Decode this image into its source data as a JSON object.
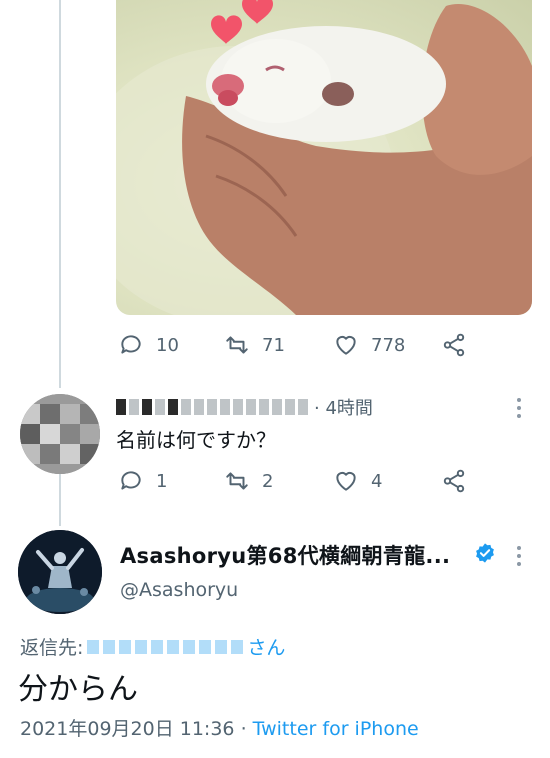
{
  "colors": {
    "accent": "#1d9bf0",
    "muted": "#536471",
    "text": "#0f1419",
    "heart": "#f2546a"
  },
  "original_tweet": {
    "image_icon": "puppy-in-hand-photo",
    "actions": {
      "reply_count": "10",
      "retweet_count": "71",
      "like_count": "778"
    }
  },
  "reply": {
    "time": "· 4時間",
    "text": "名前は何ですか？",
    "actions": {
      "reply_count": "1",
      "retweet_count": "2",
      "like_count": "4"
    }
  },
  "main_tweet": {
    "author_name": "Asashoryu第68代横綱朝青龍...",
    "handle": "@Asashoryu",
    "replying_prefix": "返信先:",
    "replying_suffix": "さん",
    "text": "分からん",
    "timestamp": "2021年09月20日 11:36",
    "separator": "·",
    "source": "Twitter for iPhone"
  }
}
